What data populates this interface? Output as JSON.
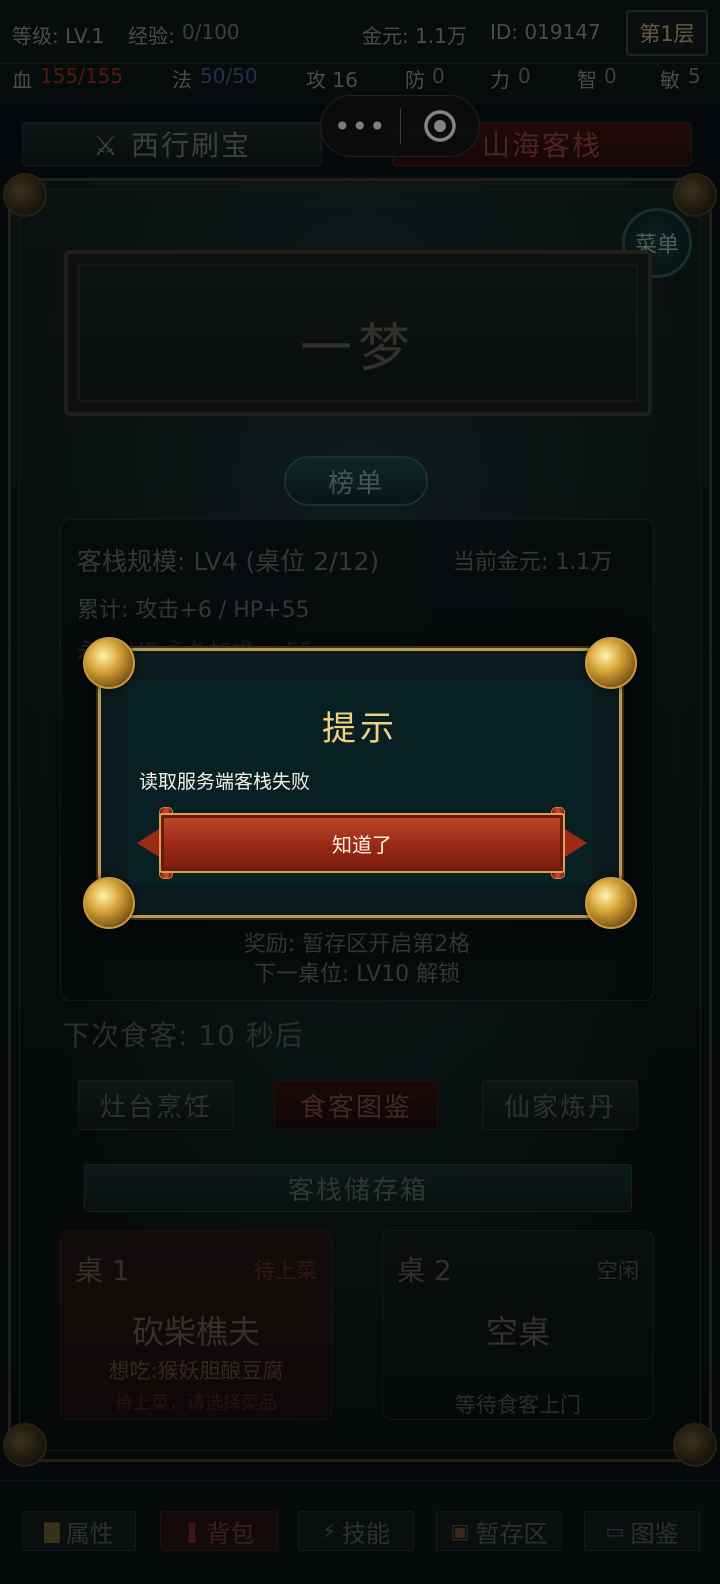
{
  "status": {
    "level_label": "等级: LV.1",
    "exp_label": "经验:",
    "exp_value": "0/100",
    "gold_label": "金元: 1.1万",
    "id_label": "ID: 019147",
    "floor": "第1层",
    "hp_label": "血",
    "hp_value": "155/155",
    "mp_label": "法",
    "mp_value": "50/50",
    "atk": "攻 16",
    "def_label": "防",
    "def_value": "0",
    "str_label": "力",
    "str_value": "0",
    "int_label": "智",
    "int_value": "0",
    "agi_label": "敏",
    "agi_value": "5"
  },
  "tabs": {
    "left": "⚔ 西行刷宝",
    "right": "山海客栈"
  },
  "capsule": {
    "more": "•••"
  },
  "main": {
    "menu": "菜单",
    "plaque_title": "一梦",
    "rank_button": "榜单",
    "info": {
      "scale": "客栈规模: LV4 (桌位 2/12)",
      "gold": "当前金元: 1.1万",
      "cumulative": "累计: 攻击+6 / HP+55",
      "partial": "永久 HP 永久加成: +55",
      "reward": "奖励: 暂存区开启第2格",
      "next_seat": "下一桌位: LV10 解锁"
    },
    "next_guest": "下次食客: 10 秒后",
    "actions": [
      "灶台烹饪",
      "食客图鉴",
      "仙家炼丹"
    ],
    "storage": "客栈储存箱",
    "tables": [
      {
        "name": "桌 1",
        "status": "待上菜",
        "main": "砍柴樵夫",
        "want": "想吃:猴妖胆酿豆腐",
        "hint": "待上菜，请选择菜品"
      },
      {
        "name": "桌 2",
        "status": "空闲",
        "main": "空桌",
        "hint": "等待食客上门"
      }
    ]
  },
  "bottom_nav": [
    {
      "icon": "▇",
      "label": "属性"
    },
    {
      "icon": "❚",
      "label": "背包"
    },
    {
      "icon": "⚡",
      "label": "技能"
    },
    {
      "icon": "▣",
      "label": "暂存区"
    },
    {
      "icon": "▭",
      "label": "图鉴"
    }
  ],
  "modal": {
    "title": "提示",
    "message": "读取服务端客栈失败",
    "ok": "知道了"
  },
  "colors": {
    "gold": "#f0d180",
    "button_red": "#9c2a16",
    "hp_red": "#9a2c22",
    "mp_blue": "#3a5b82"
  }
}
